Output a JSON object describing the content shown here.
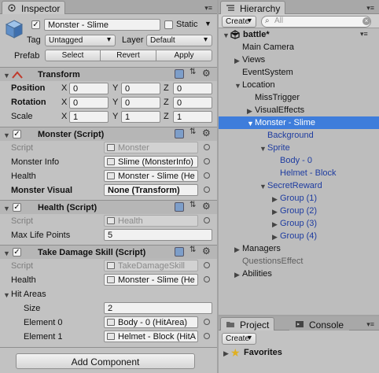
{
  "inspector": {
    "tab_label": "Inspector",
    "header": {
      "object_name": "Monster - Slime",
      "active_check": "✓",
      "static_label": "Static",
      "tag_label": "Tag",
      "tag_value": "Untagged",
      "layer_label": "Layer",
      "layer_value": "Default",
      "prefab_label": "Prefab",
      "prefab_buttons": [
        "Select",
        "Revert",
        "Apply"
      ]
    },
    "transform": {
      "title": "Transform",
      "rows": [
        {
          "label": "Position",
          "x": "0",
          "y": "0",
          "z": "0"
        },
        {
          "label": "Rotation",
          "x": "0",
          "y": "0",
          "z": "0"
        },
        {
          "label": "Scale",
          "x": "1",
          "y": "1",
          "z": "1"
        }
      ],
      "axis_labels": [
        "X",
        "Y",
        "Z"
      ]
    },
    "monster_script": {
      "title": "Monster (Script)",
      "script_label": "Script",
      "script_value": "Monster",
      "info_label": "Monster Info",
      "info_value": "Slime (MonsterInfo)",
      "health_label": "Health",
      "health_value": "Monster - Slime (He",
      "visual_label": "Monster Visual",
      "visual_value": "None (Transform)"
    },
    "health_script": {
      "title": "Health (Script)",
      "script_label": "Script",
      "script_value": "Health",
      "max_label": "Max Life Points",
      "max_value": "5"
    },
    "damage_script": {
      "title": "Take Damage Skill (Script)",
      "script_label": "Script",
      "script_value": "TakeDamageSkill",
      "health_label": "Health",
      "health_value": "Monster - Slime (He",
      "hit_label": "Hit Areas",
      "size_label": "Size",
      "size_value": "2",
      "elements": [
        {
          "label": "Element 0",
          "value": "Body - 0 (HitArea)"
        },
        {
          "label": "Element 1",
          "value": "Helmet - Block (HitA"
        }
      ]
    },
    "add_component_label": "Add Component"
  },
  "hierarchy": {
    "tab_label": "Hierarchy",
    "create_label": "Create",
    "search_placeholder": "All",
    "scene_name": "battle*",
    "items": [
      {
        "label": "Main Camera",
        "arrow": ""
      },
      {
        "label": "Views",
        "arrow": "▶"
      },
      {
        "label": "EventSystem",
        "arrow": ""
      },
      {
        "label": "Location",
        "arrow": "▼"
      },
      {
        "label": "MissTrigger",
        "arrow": ""
      },
      {
        "label": "VisualEffects",
        "arrow": "▶"
      },
      {
        "label": "Monster - Slime",
        "arrow": "▼"
      },
      {
        "label": "Background",
        "arrow": ""
      },
      {
        "label": "Sprite",
        "arrow": "▼"
      },
      {
        "label": "Body - 0",
        "arrow": ""
      },
      {
        "label": "Helmet - Block",
        "arrow": ""
      },
      {
        "label": "SecretReward",
        "arrow": "▼"
      },
      {
        "label": "Group (1)",
        "arrow": "▶"
      },
      {
        "label": "Group (2)",
        "arrow": "▶"
      },
      {
        "label": "Group (3)",
        "arrow": "▶"
      },
      {
        "label": "Group (4)",
        "arrow": "▶"
      },
      {
        "label": "Managers",
        "arrow": "▶"
      },
      {
        "label": "QuestionsEffect",
        "arrow": ""
      },
      {
        "label": "Abilities",
        "arrow": "▶"
      }
    ]
  },
  "project": {
    "tab_project": "Project",
    "tab_console": "Console",
    "create_label": "Create",
    "favorites_label": "Favorites"
  },
  "colors": {
    "selection": "#3e7ddb",
    "prefab_text": "#1e3ca0",
    "panel_bg": "#c2c2c2"
  }
}
